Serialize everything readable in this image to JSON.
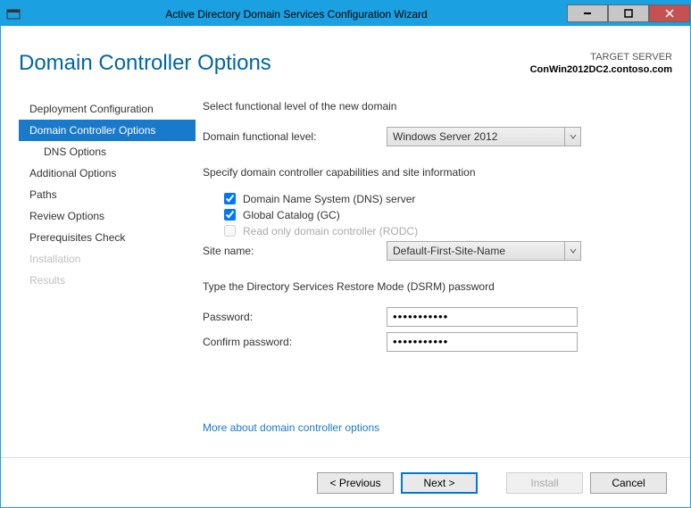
{
  "window": {
    "title": "Active Directory Domain Services Configuration Wizard"
  },
  "page": {
    "title": "Domain Controller Options"
  },
  "targetServer": {
    "label": "TARGET SERVER",
    "name": "ConWin2012DC2.contoso.com"
  },
  "sidebar": {
    "items": [
      {
        "label": "Deployment Configuration"
      },
      {
        "label": "Domain Controller Options"
      },
      {
        "label": "DNS Options"
      },
      {
        "label": "Additional Options"
      },
      {
        "label": "Paths"
      },
      {
        "label": "Review Options"
      },
      {
        "label": "Prerequisites Check"
      },
      {
        "label": "Installation"
      },
      {
        "label": "Results"
      }
    ]
  },
  "main": {
    "text1": "Select functional level of the new domain",
    "dfl_label": "Domain functional level:",
    "dfl_value": "Windows Server 2012",
    "text2": "Specify domain controller capabilities and site information",
    "chk_dns": "Domain Name System (DNS) server",
    "chk_gc": "Global Catalog (GC)",
    "chk_rodc": "Read only domain controller (RODC)",
    "site_label": "Site name:",
    "site_value": "Default-First-Site-Name",
    "text3": "Type the Directory Services Restore Mode (DSRM) password",
    "pw_label": "Password:",
    "pw_value": "•••••••••••",
    "cpw_label": "Confirm password:",
    "cpw_value": "•••••••••••",
    "link": "More about domain controller options"
  },
  "footer": {
    "previous": "< Previous",
    "next": "Next >",
    "install": "Install",
    "cancel": "Cancel"
  }
}
